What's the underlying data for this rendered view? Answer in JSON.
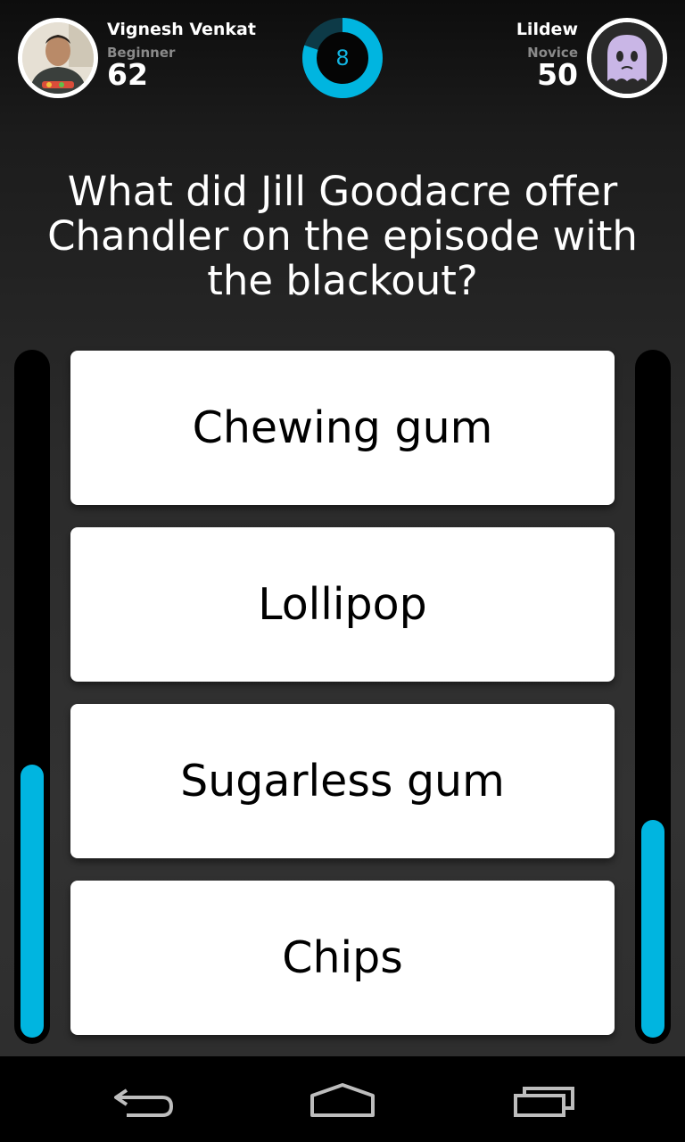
{
  "players": {
    "left": {
      "name": "Vignesh Venkat",
      "level": "Beginner",
      "score": "62",
      "avatar": "user-photo-avatar"
    },
    "right": {
      "name": "Lildew",
      "level": "Novice",
      "score": "50",
      "avatar": "ghost-avatar"
    }
  },
  "timer": {
    "value": "8",
    "remaining_fraction": 0.8
  },
  "question": "What did Jill Goodacre offer Chandler on the episode with the blackout?",
  "answers": [
    "Chewing gum",
    "Lollipop",
    "Sugarless gum",
    "Chips"
  ],
  "score_meters": {
    "left_fill_fraction": 0.4,
    "right_fill_fraction": 0.32
  },
  "navbar": {
    "icons": [
      "back-icon",
      "home-icon",
      "recent-apps-icon"
    ]
  },
  "colors": {
    "accent": "#00b5e0",
    "timer_track": "#0d3a47",
    "background": "#2b2b2b"
  }
}
